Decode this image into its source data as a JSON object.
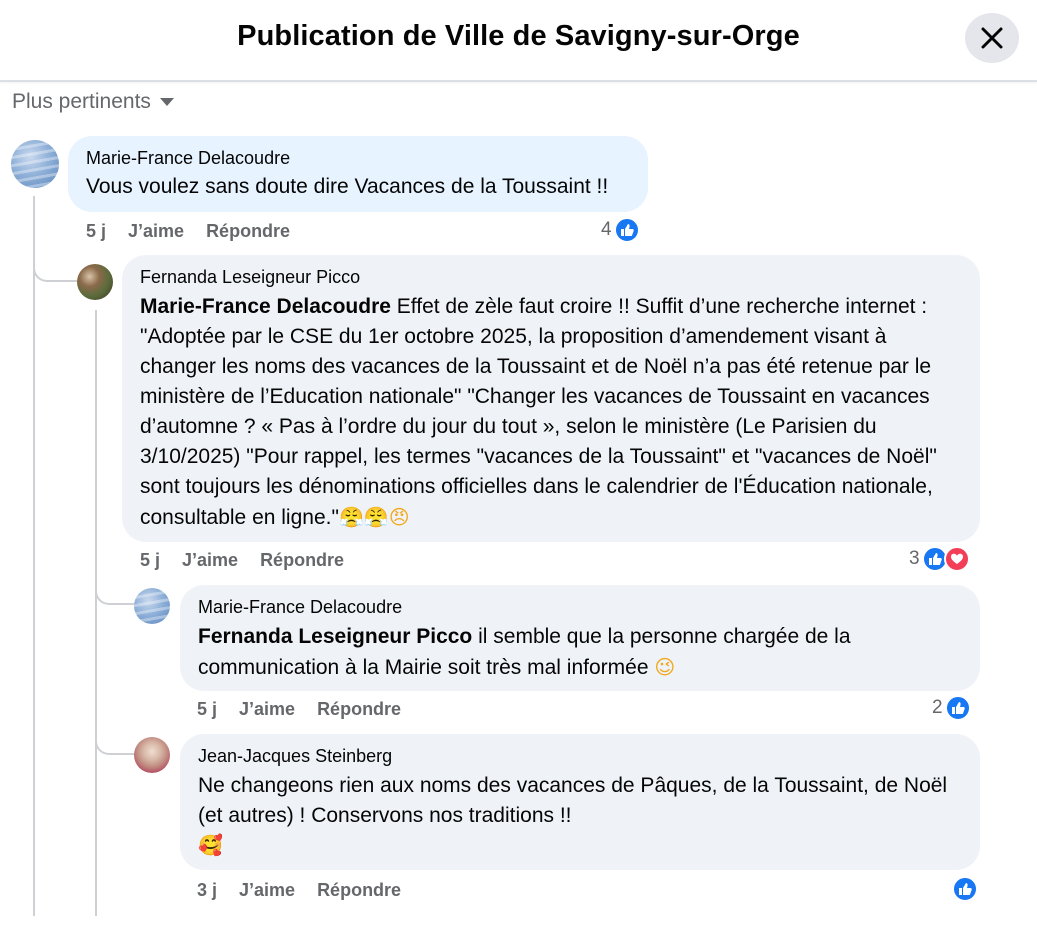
{
  "header": {
    "title": "Publication de Ville de Savigny-sur-Orge"
  },
  "sort": {
    "label": "Plus pertinents"
  },
  "actions": {
    "like": "J’aime",
    "reply": "Répondre"
  },
  "comments": [
    {
      "author": "Marie-France Delacoudre",
      "text": "Vous voulez sans doute dire Vacances de la Toussaint !!",
      "time": "5 j",
      "reaction_count": "4",
      "reactions": [
        "like"
      ]
    },
    {
      "author": "Fernanda Leseigneur Picco",
      "mention": "Marie-France Delacoudre",
      "text": " Effet de zèle faut croire !! Suffit d’une recherche internet : \"Adoptée par le CSE du 1er octobre 2025, la proposition d’amendement visant à changer les noms des vacances de la Toussaint et de Noël n’a pas été retenue par le ministère de l’Education nationale\" \"Changer les vacances de Toussaint en vacances d’automne ? « Pas à l’ordre du jour du tout », selon le ministère (Le Parisien du 3/10/2025) \"Pour rappel, les termes \"vacances de la Toussaint\" et \"vacances de Noël\" sont toujours les dénominations officielles dans le calendrier de l'Éducation nationale, consultable en ligne.\"",
      "emoji": "😤😤😠",
      "time": "5 j",
      "reaction_count": "3",
      "reactions": [
        "like",
        "love"
      ]
    },
    {
      "author": "Marie-France Delacoudre",
      "mention": "Fernanda Leseigneur Picco",
      "text": " il semble que la personne chargée de la communication à la Mairie soit très mal informée",
      "emoji": "😉",
      "time": "5 j",
      "reaction_count": "2",
      "reactions": [
        "like"
      ]
    },
    {
      "author": "Jean-Jacques Steinberg",
      "text": "Ne changeons rien aux noms des vacances de Pâques, de la Toussaint, de Noël (et autres) ! Conservons nos traditions !!",
      "emoji": "🥰",
      "time": "3 j",
      "reaction_count": "",
      "reactions": [
        "like"
      ]
    }
  ],
  "colors": {
    "accent": "#1877f2",
    "love": "#f33e58",
    "bubble": "#eff3f7",
    "bubble_highlight": "#e7f3ff",
    "secondary_text": "#65676b"
  }
}
